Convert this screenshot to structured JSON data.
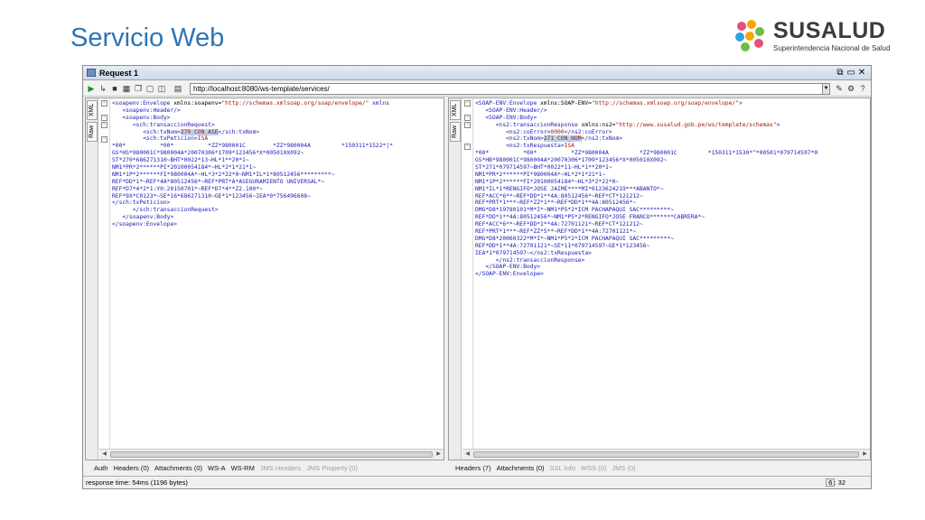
{
  "slide": {
    "title": "Servicio Web"
  },
  "logo": {
    "word": "SUSALUD",
    "subtitle": "Superintendencia Nacional de Salud",
    "colors": [
      "#e94e77",
      "#f7a600",
      "#6dbd45",
      "#2ba6de"
    ]
  },
  "window": {
    "title": "Request 1",
    "url": "http://localhost:8080/ws-template/services/",
    "title_buttons": [
      "⧉",
      "▭",
      "✕"
    ],
    "toolbar_icons": [
      "play-icon",
      "add-icon",
      "stop-icon",
      "grid-icon",
      "copy-icon",
      "paste-icon",
      "split-icon",
      "format-icon"
    ]
  },
  "request": {
    "side_tabs": [
      "XML",
      "Raw"
    ],
    "lines": [
      {
        "p": "<soapenv:Envelope",
        "a": " xmlns:soapenv=",
        "v": "\"http://schemas.xmlsoap.org/soap/envelope/\"",
        "r": " xmlns"
      },
      {
        "p": "   <soapenv:Header/>",
        "a": "",
        "v": "",
        "r": ""
      },
      {
        "p": "   <soapenv:Body>",
        "a": "",
        "v": "",
        "r": ""
      },
      {
        "p": "      <sch:transaccionRequest>",
        "a": "",
        "v": "",
        "r": ""
      },
      {
        "p": "         <sch:txNom>",
        "a": "",
        "v": "270_CON_ASE",
        "r": "</sch:txNom>"
      },
      {
        "p": "         <sch:txPeticion>",
        "a": "",
        "v": "ISA",
        "r": ""
      },
      {
        "p": "*00*          *00*          *ZZ*980001C        *ZZ*980004A         *150311*1522*|*",
        "a": "",
        "v": "",
        "r": ""
      },
      {
        "p": "GS*HS*980001C*980004A*20070306*1709*123456*X*005010X092~",
        "a": "",
        "v": "",
        "r": ""
      },
      {
        "p": "ST*270*686271310~BHT*0022*13~HL*1**20*1~",
        "a": "",
        "v": "",
        "r": ""
      },
      {
        "p": "NM1*PR*2******PI*20100054184*~HL*2*1*21*1~",
        "a": "",
        "v": "",
        "r": ""
      },
      {
        "p": "NM1*1P*2******FI*980004A*~HL*3*2*22*0~NM1*IL*1*80512456*********~",
        "a": "",
        "v": "",
        "r": ""
      },
      {
        "p": "REF*DD*1*~REF*4A*80512456*~REF*PRT*A*ASEGURAMIENTO UNIVERSAL*~",
        "a": "",
        "v": "",
        "r": ""
      },
      {
        "p": "REF*D7*4*2*1:Y0:20150701*~REF*D7*4**Z2.100*~",
        "a": "",
        "v": "",
        "r": ""
      },
      {
        "p": "REF*9X*C0123*~SE*16*686271310~GE*1*123456~IEA*0*756496608~",
        "a": "",
        "v": "",
        "r": ""
      },
      {
        "p": "</sch:txPeticion>",
        "a": "",
        "v": "",
        "r": ""
      },
      {
        "p": "      </sch:transaccionRequest>",
        "a": "",
        "v": "",
        "r": ""
      },
      {
        "p": "   </soapenv:Body>",
        "a": "",
        "v": "",
        "r": ""
      },
      {
        "p": "</soapenv:Envelope>",
        "a": "",
        "v": "",
        "r": ""
      }
    ],
    "tabs": [
      {
        "label": "Auth",
        "enabled": true
      },
      {
        "label": "Headers (0)",
        "enabled": true
      },
      {
        "label": "Attachments (0)",
        "enabled": true
      },
      {
        "label": "WS-A",
        "enabled": true
      },
      {
        "label": "WS-RM",
        "enabled": true
      },
      {
        "label": "JMS Headers",
        "enabled": false
      },
      {
        "label": "JMS Property (0)",
        "enabled": false
      }
    ]
  },
  "response": {
    "side_tabs": [
      "XML",
      "Raw"
    ],
    "lines": [
      {
        "p": "<SOAP-ENV:Envelope",
        "a": " xmlns:SOAP-ENV=",
        "v": "\"http://schemas.xmlsoap.org/soap/envelope/\"",
        "r": ">"
      },
      {
        "p": "   <SOAP-ENV:Header/>",
        "a": "",
        "v": "",
        "r": ""
      },
      {
        "p": "   <SOAP-ENV:Body>",
        "a": "",
        "v": "",
        "r": ""
      },
      {
        "p": "      <ns2:transaccionResponse",
        "a": " xmlns:ns2=",
        "v": "\"http://www.susalud.gob.pe/ws/template/schemas\"",
        "r": ">"
      },
      {
        "p": "         <ns2:coError>",
        "a": "",
        "v": "0000",
        "r": "</ns2:coError>"
      },
      {
        "p": "         <ns2:txNom>",
        "a": "",
        "v": "271_CON_NOM",
        "r": "</ns2:txNom>"
      },
      {
        "p": "         <ns2:txRespuesta>",
        "a": "",
        "v": "ISA",
        "r": ""
      },
      {
        "p": "*00*          *00*          *ZZ*980004A         *ZZ*980001C         *150311*1530*^*00501*079714597*0",
        "a": "",
        "v": "",
        "r": ""
      },
      {
        "p": "GS*HB*980001C*980004A*20070306*1709*123456*X*005010X092~",
        "a": "",
        "v": "",
        "r": ""
      },
      {
        "p": "ST*271*079714597~BHT*0022*11~HL*1**20*1~",
        "a": "",
        "v": "",
        "r": ""
      },
      {
        "p": "NM1*PR*2******PI*980004A*~HL*2*1*21*1~",
        "a": "",
        "v": "",
        "r": ""
      },
      {
        "p": "NM1*1P*2******FI*20100054184*~HL*3*2*22*0~",
        "a": "",
        "v": "",
        "r": ""
      },
      {
        "p": "NM1*IL*1*RENGIFO*JOSE JAIME****MI*0123624219***ABANTO*~",
        "a": "",
        "v": "",
        "r": ""
      },
      {
        "p": "REF*ACC*6**~REF*DD*1**4A:80512456*~REF*CT*121212~",
        "a": "",
        "v": "",
        "r": ""
      },
      {
        "p": "REF*PRT*1***~REF*ZZ*1**~REF*DD*1**4A:80512456*~",
        "a": "",
        "v": "",
        "r": ""
      },
      {
        "p": "DMG*D8*19780101*M*I*~NM1*P5*2*ICM PACHAPAQUI SAC*********~",
        "a": "",
        "v": "",
        "r": ""
      },
      {
        "p": "REF*DD*1**4A:80512456*~NM1*P5*2*RENGIFO*JOSE FRANCO*******CABRERA*~",
        "a": "",
        "v": "",
        "r": ""
      },
      {
        "p": "REF*ACC*6**~REF*DD*1**4A:72701121*~REF*CT*121212~",
        "a": "",
        "v": "",
        "r": ""
      },
      {
        "p": "REF*PRT*1***~REF*ZZ*5**~REF*DD*1**4A:72701121*~",
        "a": "",
        "v": "",
        "r": ""
      },
      {
        "p": "DMG*D8*20060322*M*I*~NM1*P5*2*ICM PACHAPAQUI SAC*********~",
        "a": "",
        "v": "",
        "r": ""
      },
      {
        "p": "REF*DD*1**4A:72701121*~SE*11*079714597~GE*1*123456~",
        "a": "",
        "v": "",
        "r": ""
      },
      {
        "p": "IEA*1*079714597~</ns2:txRespuesta>",
        "a": "",
        "v": "",
        "r": ""
      },
      {
        "p": "      </ns2:transaccionResponse>",
        "a": "",
        "v": "",
        "r": ""
      },
      {
        "p": "   </SOAP-ENV:Body>",
        "a": "",
        "v": "",
        "r": ""
      },
      {
        "p": "</SOAP-ENV:Envelope>",
        "a": "",
        "v": "",
        "r": ""
      }
    ],
    "tabs": [
      {
        "label": "Headers (7)",
        "enabled": true
      },
      {
        "label": "Attachments (0)",
        "enabled": true
      },
      {
        "label": "SSL Info",
        "enabled": false
      },
      {
        "label": "WSS (0)",
        "enabled": false
      },
      {
        "label": "JMS (0)",
        "enabled": false
      }
    ]
  },
  "status": {
    "response_time": "response time: 54ms (1196 bytes)",
    "cursor": "6 : 32"
  }
}
